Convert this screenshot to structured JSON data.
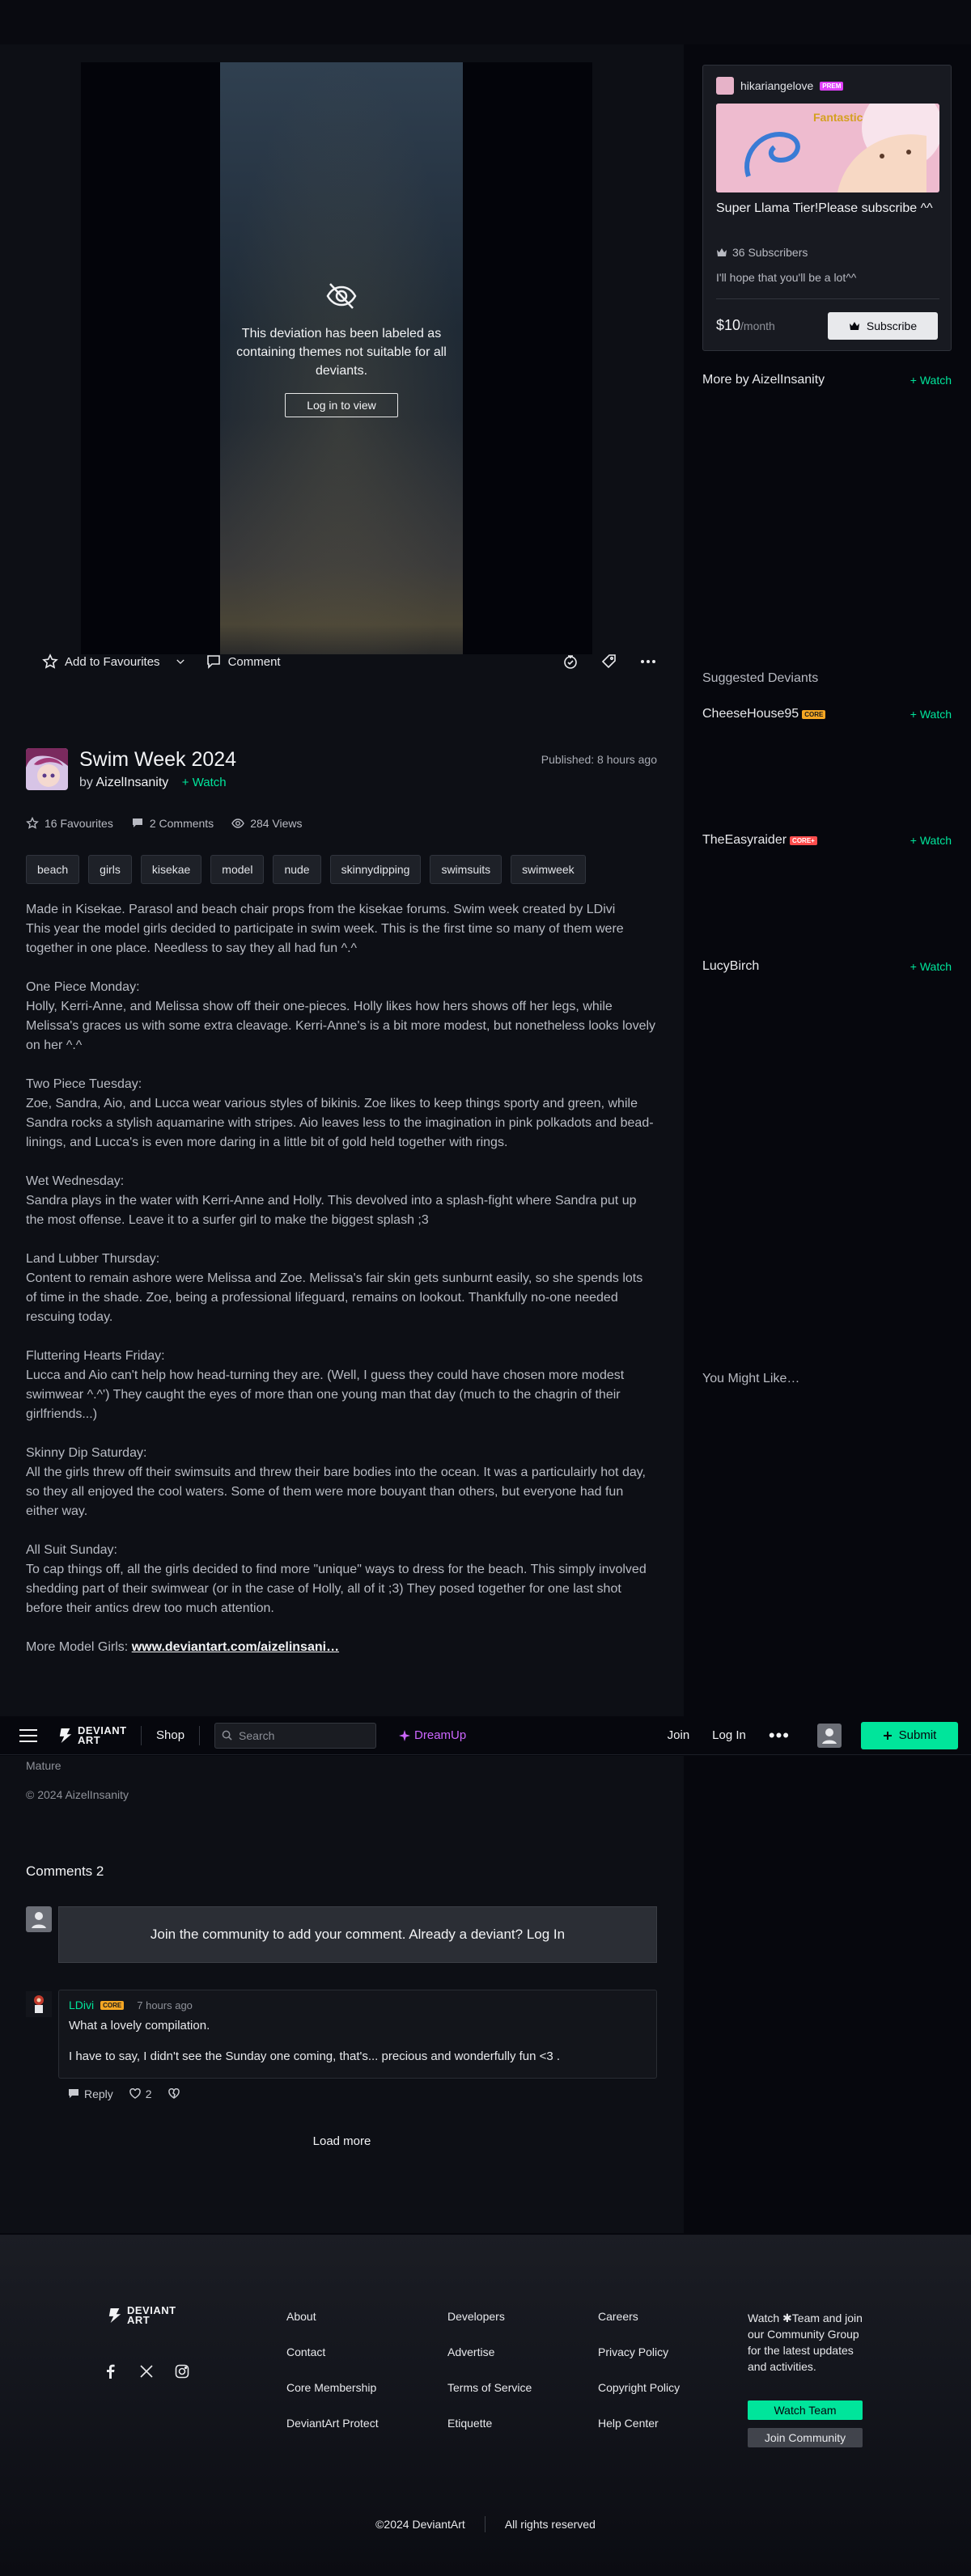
{
  "deviation": {
    "mature_notice": "This deviation has been labeled as containing themes not suitable for all deviants.",
    "login_to_view": "Log in to view",
    "title": "Swim Week 2024",
    "by": "by",
    "author": "AizelInsanity",
    "watch": "Watch",
    "published": "Published: 8 hours ago",
    "add_to_favourites": "Add to Favourites",
    "comment": "Comment",
    "stats": {
      "favourites": "16 Favourites",
      "comments": "2 Comments",
      "views": "284 Views"
    },
    "tags": [
      "beach",
      "girls",
      "kisekae",
      "model",
      "nude",
      "skinnydipping",
      "swimsuits",
      "swimweek"
    ],
    "description": [
      "Made in Kisekae. Parasol and beach chair props from the kisekae forums.  Swim week created by LDivi\nThis year the model girls decided to participate in swim week. This is the first time so many of them were together in one place. Needless to say they all had fun ^.^",
      "One Piece Monday:\nHolly, Kerri-Anne, and Melissa show off their one-pieces. Holly likes how hers shows off her legs, while Melissa's graces us with some extra cleavage. Kerri-Anne's is a bit more modest, but nonetheless looks lovely on her ^.^",
      "Two Piece Tuesday:\nZoe, Sandra, Aio, and Lucca wear various styles of bikinis. Zoe likes to keep things sporty and green, while Sandra rocks a stylish aquamarine with stripes. Aio leaves less to the imagination in pink polkadots and bead-linings, and Lucca's is even more daring in a little bit of gold held together with rings.",
      "Wet Wednesday:\nSandra plays in the water with Kerri-Anne and Holly. This devolved into a splash-fight where Sandra put up the most offense. Leave it to a surfer girl to make the biggest splash ;3",
      "Land Lubber Thursday:\nContent to remain ashore were Melissa and Zoe. Melissa's fair skin gets sunburnt easily, so she spends lots of time in the shade. Zoe, being a professional lifeguard, remains on lookout. Thankfully no-one needed rescuing today.",
      "Fluttering Hearts Friday:\nLucca and Aio can't help how head-turning they are. (Well, I guess they could have chosen more modest swimwear ^.^') They caught the eyes of more than one young man that day (much to the chagrin of their girlfriends...)",
      "Skinny Dip Saturday:\nAll the girls threw off their swimsuits and threw their bare bodies into the ocean. It was a particulairly hot day, so they all enjoyed the cool waters. Some of them were more bouyant than others, but everyone had fun either way.",
      "All Suit Sunday:\nTo cap things off, all the girls decided to find more \"unique\" ways to dress for the beach. This simply involved shedding part of their swimwear (or in the case of Holly, all of it ;3) They posed together for one last shot before their antics drew too much attention."
    ],
    "more_label": "More Model Girls: ",
    "more_link": "www.deviantart.com/aizelinsani…",
    "mature": "Mature",
    "copyright": "© 2024 AizelInsanity"
  },
  "nav": {
    "logo": "DEVIANT ART",
    "shop": "Shop",
    "search_placeholder": "Search",
    "dreamup": "DreamUp",
    "join": "Join",
    "login": "Log In",
    "submit": "Submit"
  },
  "comments": {
    "header": "Comments 2",
    "join_prompt": "Join the community to add your comment. Already a deviant? Log In",
    "items": [
      {
        "user": "LDivi",
        "badge": "CORE",
        "time": "7 hours ago",
        "line1": "What a lovely compilation.",
        "line2": "I have to say, I didn't see the Sunday one coming, that's... precious and wonderfully fun <3 .",
        "reply": "Reply",
        "likes": "2"
      }
    ],
    "load_more": "Load more"
  },
  "sidebar": {
    "subscription": {
      "user": "hikariangelove",
      "badge": "PREM",
      "title": "Super Llama Tier!Please subscribe ^^",
      "subscribers": "36 Subscribers",
      "note": "I'll hope that you'll be a lot^^",
      "price": "$10",
      "per": "/month",
      "subscribe": "Subscribe"
    },
    "more_by": "More by AizelInsanity",
    "watch": "Watch",
    "suggested_header": "Suggested Deviants",
    "suggested": [
      {
        "name": "CheeseHouse95",
        "badge": "CORE"
      },
      {
        "name": "TheEasyraider",
        "badge": "CORE+"
      },
      {
        "name": "LucyBirch",
        "badge": ""
      }
    ],
    "you_might_like": "You Might Like…"
  },
  "footer": {
    "logo": "DEVIANT ART",
    "col1": [
      "About",
      "Contact",
      "Core Membership",
      "DeviantArt Protect"
    ],
    "col2": [
      "Developers",
      "Advertise",
      "Terms of Service",
      "Etiquette"
    ],
    "col3": [
      "Careers",
      "Privacy Policy",
      "Copyright Policy",
      "Help Center"
    ],
    "team_text": "Watch ✱Team and join our Community Group for the latest updates and activities.",
    "watch_team": "Watch Team",
    "join_community": "Join Community",
    "copyright": "©2024 DeviantArt",
    "rights": "All rights reserved"
  },
  "colors": {
    "accent": "#00e59b",
    "dreamup": "#cc66ff",
    "background": "#06070d",
    "panel": "#0d0f15"
  }
}
